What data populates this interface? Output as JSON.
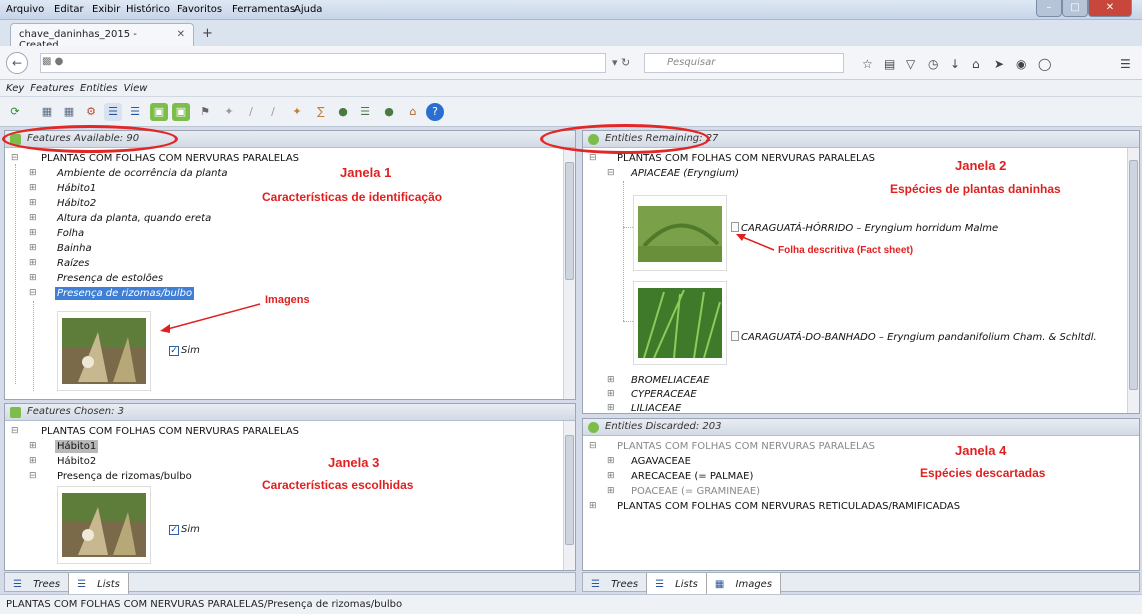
{
  "browser": {
    "menu": [
      "Arquivo",
      "Editar",
      "Exibir",
      "Histórico",
      "Favoritos",
      "Ferramentas",
      "Ajuda"
    ],
    "tab_title": "chave_daninhas_2015 - Created...",
    "search_placeholder": "Pesquisar"
  },
  "app": {
    "menu": [
      "Key",
      "Features",
      "Entities",
      "View"
    ]
  },
  "features_available": {
    "header": "Features Available: 90",
    "root": "PLANTAS COM FOLHAS COM NERVURAS PARALELAS",
    "items": [
      "Ambiente de ocorrência da planta",
      "Hábito1",
      "Hábito2",
      "Altura da planta, quando ereta",
      "Folha",
      "Bainha",
      "Raízes",
      "Presença de estolões",
      "Presença de rizomas/bulbo"
    ],
    "checkbox_label": "Sim"
  },
  "features_chosen": {
    "header": "Features Chosen: 3",
    "root": "PLANTAS COM FOLHAS COM NERVURAS PARALELAS",
    "items": [
      "Hábito1",
      "Hábito2",
      "Presença de rizomas/bulbo"
    ],
    "checkbox_label": "Sim"
  },
  "entities_remaining": {
    "header": "Entities Remaining: 27",
    "root": "PLANTAS COM FOLHAS COM NERVURAS PARALELAS",
    "family": "APIACEAE (Eryngium)",
    "species": [
      "CARAGUATÁ-HÓRRIDO – Eryngium horridum Malme",
      "CARAGUATÁ-DO-BANHADO – Eryngium pandanifolium Cham. & Schltdl."
    ],
    "other_families": [
      "BROMELIACEAE",
      "CYPERACEAE",
      "LILIACEAE"
    ]
  },
  "entities_discarded": {
    "header": "Entities Discarded: 203",
    "root": "PLANTAS COM FOLHAS COM NERVURAS PARALELAS",
    "items": [
      "AGAVACEAE",
      "ARECACEAE (= PALMAE)",
      "POACEAE (= GRAMINEAE)"
    ],
    "root2": "PLANTAS COM FOLHAS COM NERVURAS RETICULADAS/RAMIFICADAS"
  },
  "bottom_tabs": {
    "left": [
      "Trees",
      "Lists"
    ],
    "right": [
      "Trees",
      "Lists",
      "Images"
    ]
  },
  "annotations": {
    "janela1": "Janela 1",
    "janela1_sub": "Características de identificação",
    "janela2": "Janela 2",
    "janela2_sub": "Espécies de plantas daninhas",
    "janela3": "Janela 3",
    "janela3_sub": "Características escolhidas",
    "janela4": "Janela 4",
    "janela4_sub": "Espécies descartadas",
    "imagens": "Imagens",
    "fact_sheet": "Folha descritiva (Fact sheet)"
  },
  "status": "PLANTAS COM FOLHAS COM NERVURAS PARALELAS/Presença de rizomas/bulbo"
}
